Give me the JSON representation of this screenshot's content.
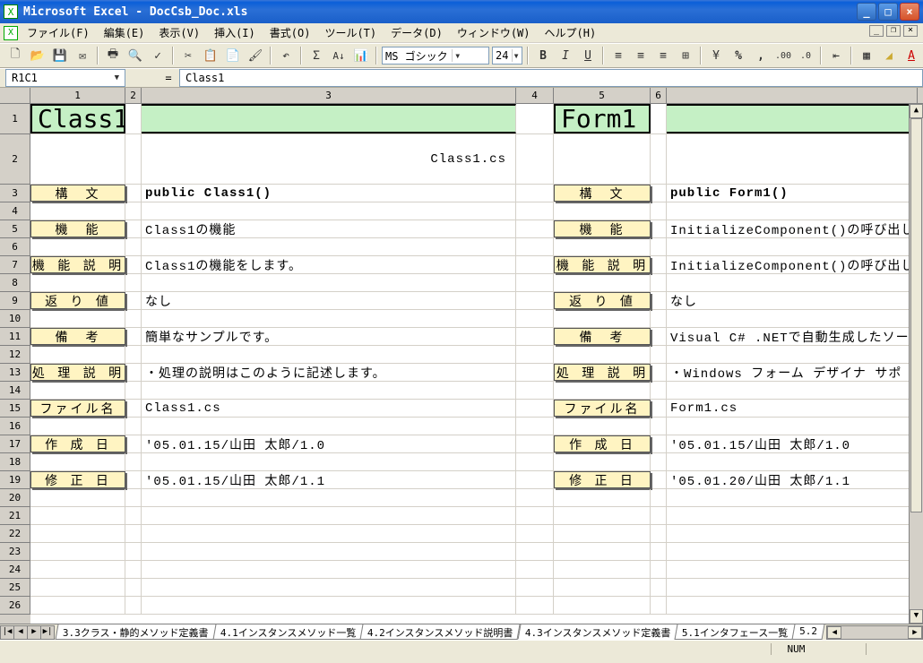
{
  "window": {
    "title": "Microsoft Excel - DocCsb_Doc.xls"
  },
  "menu": {
    "file": "ファイル(F)",
    "edit": "編集(E)",
    "view": "表示(V)",
    "insert": "挿入(I)",
    "format": "書式(O)",
    "tools": "ツール(T)",
    "data": "データ(D)",
    "window": "ウィンドウ(W)",
    "help": "ヘルプ(H)"
  },
  "font": {
    "name": "MS ゴシック",
    "size": "24"
  },
  "namebox": "R1C1",
  "formula": "Class1",
  "cols": [
    "1",
    "2",
    "3",
    "4",
    "5",
    "6"
  ],
  "rows": [
    "1",
    "2",
    "3",
    "4",
    "5",
    "6",
    "7",
    "8",
    "9",
    "10",
    "11",
    "12",
    "13",
    "14",
    "15",
    "16",
    "17",
    "18",
    "19",
    "20",
    "21",
    "22",
    "23",
    "24",
    "25",
    "26"
  ],
  "left": {
    "title": "Class1",
    "subtitle": "Class1.cs",
    "rows": [
      {
        "tag": "構　文",
        "val": "public Class1()",
        "bold": true
      },
      {
        "tag": "機　能",
        "val": "Class1の機能"
      },
      {
        "tag": "機 能 説 明",
        "val": "Class1の機能をします。"
      },
      {
        "tag": "返 り 値",
        "val": "なし"
      },
      {
        "tag": "備　考",
        "val": "簡単なサンプルです。"
      },
      {
        "tag": "処 理 説 明",
        "val": "・処理の説明はこのように記述します。"
      },
      {
        "tag": "ファイル名",
        "val": "Class1.cs"
      },
      {
        "tag": "作 成 日",
        "val": "'05.01.15/山田 太郎/1.0"
      },
      {
        "tag": "修 正 日",
        "val": "'05.01.15/山田 太郎/1.1"
      }
    ]
  },
  "right": {
    "title": "Form1",
    "rows": [
      {
        "tag": "構　文",
        "val": "public Form1()",
        "bold": true
      },
      {
        "tag": "機　能",
        "val": "InitializeComponent()の呼び出し"
      },
      {
        "tag": "機 能 説 明",
        "val": "InitializeComponent()の呼び出しを"
      },
      {
        "tag": "返 り 値",
        "val": "なし"
      },
      {
        "tag": "備　考",
        "val": "Visual C# .NETで自動生成したソー"
      },
      {
        "tag": "処 理 説 明",
        "val": "・Windows フォーム デザイナ サポ"
      },
      {
        "tag": "ファイル名",
        "val": "Form1.cs"
      },
      {
        "tag": "作 成 日",
        "val": "'05.01.15/山田 太郎/1.0"
      },
      {
        "tag": "修 正 日",
        "val": "'05.01.20/山田 太郎/1.1"
      }
    ]
  },
  "tabs": [
    "3.3クラス・静的メソッド定義書",
    "4.1インスタンスメソッド一覧",
    "4.2インスタンスメソッド説明書",
    "4.3インスタンスメソッド定義書",
    "5.1インタフェース一覧",
    "5.2"
  ],
  "active_tab": 3,
  "status": {
    "num": "NUM"
  }
}
